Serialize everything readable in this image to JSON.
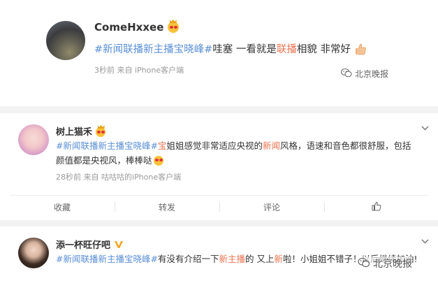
{
  "post": {
    "username": "ComeHxxee",
    "text_parts": [
      {
        "t": "#新闻联播新主播宝晓峰#",
        "c": "tag"
      },
      {
        "t": "哇塞 一看就是",
        "c": ""
      },
      {
        "t": "联播",
        "c": "hl"
      },
      {
        "t": "相貌 非常好",
        "c": ""
      }
    ],
    "meta": "3秒前  来自 iPhone客户端",
    "watermark": "北京晚报"
  },
  "comments": [
    {
      "username": "树上猫禾",
      "text_parts": [
        {
          "t": "#新闻联播新主播宝晓峰#",
          "c": "tag"
        },
        {
          "t": "宝",
          "c": "hl"
        },
        {
          "t": "姐姐感觉非常适应央视的",
          "c": ""
        },
        {
          "t": "新闻",
          "c": "hl"
        },
        {
          "t": "风格，语速和音色都很舒服，包括颜值都是央视风，棒棒哒",
          "c": ""
        }
      ],
      "meta": "28秒前  来自 咕咕咕的iPhone客户端"
    },
    {
      "username": "添一杯旺仔吧",
      "text_parts": [
        {
          "t": "#新闻联播新主播宝晓峰#",
          "c": "tag"
        },
        {
          "t": "有没有介绍一下",
          "c": ""
        },
        {
          "t": "新主播",
          "c": "hl"
        },
        {
          "t": "的 又上",
          "c": ""
        },
        {
          "t": "新",
          "c": "hl"
        },
        {
          "t": "啦！小姐姐不错子！以后继续加油!",
          "c": ""
        }
      ]
    }
  ],
  "actions": [
    "收藏",
    "转发",
    "评论",
    ""
  ],
  "watermark2": "北京晚报",
  "icons": {
    "crown_emoji": "crown-smile-emoji",
    "thumbs_up": "thumbs-up-emoji",
    "chevron": "chevron-down-icon",
    "like": "like-icon",
    "vip_badge": "vip-badge-icon",
    "wechat_logo": "wechat-logo-icon"
  },
  "colors": {
    "tag": "#5b8fd6",
    "highlight": "#eb7350",
    "meta": "#9a9a9a",
    "divider": "#f2f2f2"
  }
}
